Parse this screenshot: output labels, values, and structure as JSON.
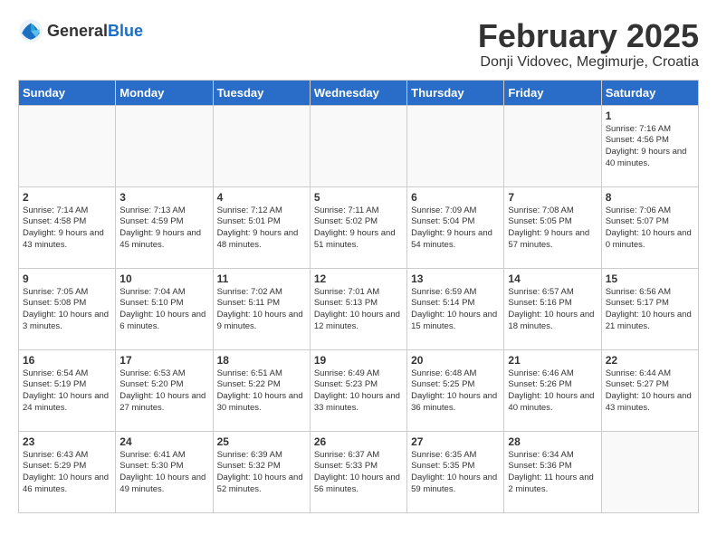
{
  "logo": {
    "general": "General",
    "blue": "Blue"
  },
  "header": {
    "month": "February 2025",
    "location": "Donji Vidovec, Megimurje, Croatia"
  },
  "weekdays": [
    "Sunday",
    "Monday",
    "Tuesday",
    "Wednesday",
    "Thursday",
    "Friday",
    "Saturday"
  ],
  "weeks": [
    [
      {
        "day": "",
        "info": ""
      },
      {
        "day": "",
        "info": ""
      },
      {
        "day": "",
        "info": ""
      },
      {
        "day": "",
        "info": ""
      },
      {
        "day": "",
        "info": ""
      },
      {
        "day": "",
        "info": ""
      },
      {
        "day": "1",
        "info": "Sunrise: 7:16 AM\nSunset: 4:56 PM\nDaylight: 9 hours and 40 minutes."
      }
    ],
    [
      {
        "day": "2",
        "info": "Sunrise: 7:14 AM\nSunset: 4:58 PM\nDaylight: 9 hours and 43 minutes."
      },
      {
        "day": "3",
        "info": "Sunrise: 7:13 AM\nSunset: 4:59 PM\nDaylight: 9 hours and 45 minutes."
      },
      {
        "day": "4",
        "info": "Sunrise: 7:12 AM\nSunset: 5:01 PM\nDaylight: 9 hours and 48 minutes."
      },
      {
        "day": "5",
        "info": "Sunrise: 7:11 AM\nSunset: 5:02 PM\nDaylight: 9 hours and 51 minutes."
      },
      {
        "day": "6",
        "info": "Sunrise: 7:09 AM\nSunset: 5:04 PM\nDaylight: 9 hours and 54 minutes."
      },
      {
        "day": "7",
        "info": "Sunrise: 7:08 AM\nSunset: 5:05 PM\nDaylight: 9 hours and 57 minutes."
      },
      {
        "day": "8",
        "info": "Sunrise: 7:06 AM\nSunset: 5:07 PM\nDaylight: 10 hours and 0 minutes."
      }
    ],
    [
      {
        "day": "9",
        "info": "Sunrise: 7:05 AM\nSunset: 5:08 PM\nDaylight: 10 hours and 3 minutes."
      },
      {
        "day": "10",
        "info": "Sunrise: 7:04 AM\nSunset: 5:10 PM\nDaylight: 10 hours and 6 minutes."
      },
      {
        "day": "11",
        "info": "Sunrise: 7:02 AM\nSunset: 5:11 PM\nDaylight: 10 hours and 9 minutes."
      },
      {
        "day": "12",
        "info": "Sunrise: 7:01 AM\nSunset: 5:13 PM\nDaylight: 10 hours and 12 minutes."
      },
      {
        "day": "13",
        "info": "Sunrise: 6:59 AM\nSunset: 5:14 PM\nDaylight: 10 hours and 15 minutes."
      },
      {
        "day": "14",
        "info": "Sunrise: 6:57 AM\nSunset: 5:16 PM\nDaylight: 10 hours and 18 minutes."
      },
      {
        "day": "15",
        "info": "Sunrise: 6:56 AM\nSunset: 5:17 PM\nDaylight: 10 hours and 21 minutes."
      }
    ],
    [
      {
        "day": "16",
        "info": "Sunrise: 6:54 AM\nSunset: 5:19 PM\nDaylight: 10 hours and 24 minutes."
      },
      {
        "day": "17",
        "info": "Sunrise: 6:53 AM\nSunset: 5:20 PM\nDaylight: 10 hours and 27 minutes."
      },
      {
        "day": "18",
        "info": "Sunrise: 6:51 AM\nSunset: 5:22 PM\nDaylight: 10 hours and 30 minutes."
      },
      {
        "day": "19",
        "info": "Sunrise: 6:49 AM\nSunset: 5:23 PM\nDaylight: 10 hours and 33 minutes."
      },
      {
        "day": "20",
        "info": "Sunrise: 6:48 AM\nSunset: 5:25 PM\nDaylight: 10 hours and 36 minutes."
      },
      {
        "day": "21",
        "info": "Sunrise: 6:46 AM\nSunset: 5:26 PM\nDaylight: 10 hours and 40 minutes."
      },
      {
        "day": "22",
        "info": "Sunrise: 6:44 AM\nSunset: 5:27 PM\nDaylight: 10 hours and 43 minutes."
      }
    ],
    [
      {
        "day": "23",
        "info": "Sunrise: 6:43 AM\nSunset: 5:29 PM\nDaylight: 10 hours and 46 minutes."
      },
      {
        "day": "24",
        "info": "Sunrise: 6:41 AM\nSunset: 5:30 PM\nDaylight: 10 hours and 49 minutes."
      },
      {
        "day": "25",
        "info": "Sunrise: 6:39 AM\nSunset: 5:32 PM\nDaylight: 10 hours and 52 minutes."
      },
      {
        "day": "26",
        "info": "Sunrise: 6:37 AM\nSunset: 5:33 PM\nDaylight: 10 hours and 56 minutes."
      },
      {
        "day": "27",
        "info": "Sunrise: 6:35 AM\nSunset: 5:35 PM\nDaylight: 10 hours and 59 minutes."
      },
      {
        "day": "28",
        "info": "Sunrise: 6:34 AM\nSunset: 5:36 PM\nDaylight: 11 hours and 2 minutes."
      },
      {
        "day": "",
        "info": ""
      }
    ]
  ]
}
